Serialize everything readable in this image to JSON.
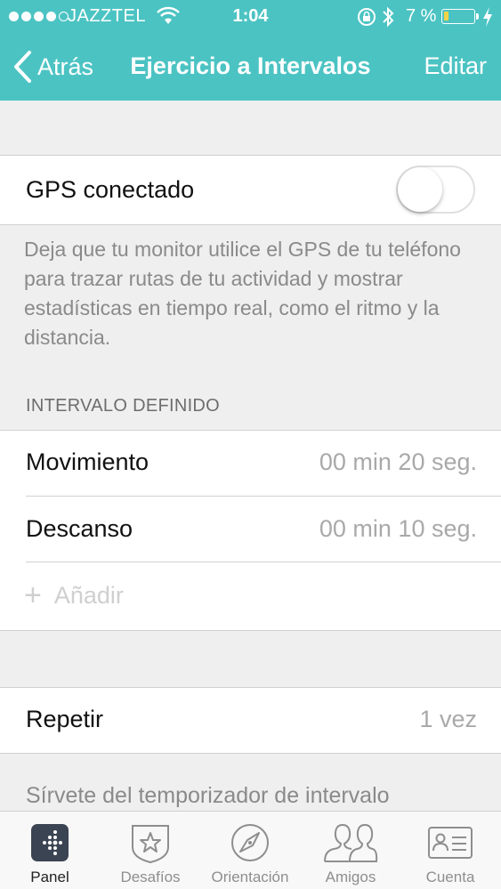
{
  "status_bar": {
    "carrier": "JAZZTEL",
    "time": "1:04",
    "battery_percent": "7 %",
    "signal_bars": 4,
    "signal_max": 5
  },
  "nav": {
    "back_label": "Atrás",
    "title": "Ejercicio a Intervalos",
    "edit_label": "Editar"
  },
  "gps": {
    "label": "GPS conectado",
    "enabled": false,
    "description": "Deja que tu monitor utilice el GPS de tu teléfono para trazar rutas de tu actividad y mostrar estadísticas en tiempo real, como el ritmo y la distancia."
  },
  "intervals": {
    "header": "INTERVALO DEFINIDO",
    "rows": [
      {
        "label": "Movimiento",
        "value": "00 min 20 seg."
      },
      {
        "label": "Descanso",
        "value": "00 min 10 seg."
      }
    ],
    "add_label": "Añadir"
  },
  "repeat": {
    "label": "Repetir",
    "value": "1 vez",
    "description": "Sírvete del temporizador de intervalo"
  },
  "tabs": [
    {
      "label": "Panel",
      "icon": "panel-icon",
      "active": true
    },
    {
      "label": "Desafíos",
      "icon": "challenges-icon",
      "active": false
    },
    {
      "label": "Orientación",
      "icon": "compass-icon",
      "active": false
    },
    {
      "label": "Amigos",
      "icon": "friends-icon",
      "active": false
    },
    {
      "label": "Cuenta",
      "icon": "account-icon",
      "active": false
    }
  ],
  "colors": {
    "accent": "#4cc3c3",
    "battery_low": "#f3d34a"
  }
}
